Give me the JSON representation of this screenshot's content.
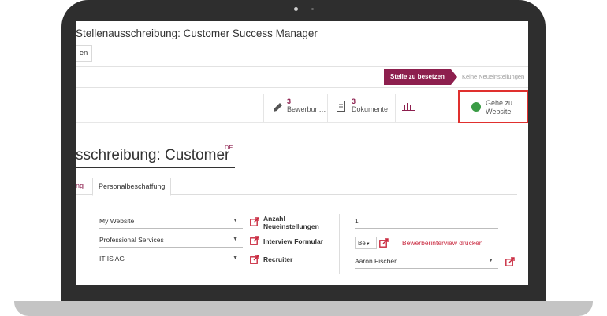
{
  "window": {
    "title": "Stellenausschreibung: Customer Success Manager",
    "back_label": "en"
  },
  "stages": {
    "active": "Stelle zu besetzen",
    "inactive": "Keine Neueinstellungen"
  },
  "stat_buttons": [
    {
      "count": "3",
      "label": "Bewerbun…"
    },
    {
      "count": "3",
      "label": "Dokumente"
    }
  ],
  "website_button": {
    "label_line1": "Gehe zu",
    "label_line2": "Website"
  },
  "form": {
    "title": "sschreibung: Customer",
    "lang": "DE"
  },
  "tabs": {
    "prev_tab": "ng",
    "active_tab": "Personalbeschaffung"
  },
  "fields": {
    "website": "My Website",
    "department": "Professional Services",
    "company": "IT IS AG",
    "new_hires_label": "Anzahl Neueinstellungen",
    "new_hires_value": "1",
    "interview_form_label": "Interview Formular",
    "interview_select": "Be",
    "print_interview": "Bewerberinterview drucken",
    "recruiter_label": "Recruiter",
    "recruiter_value": "Aaron Fischer"
  },
  "colors": {
    "brand": "#8d1f4e",
    "highlight": "#e0302e",
    "globe": "#3a9b45"
  }
}
